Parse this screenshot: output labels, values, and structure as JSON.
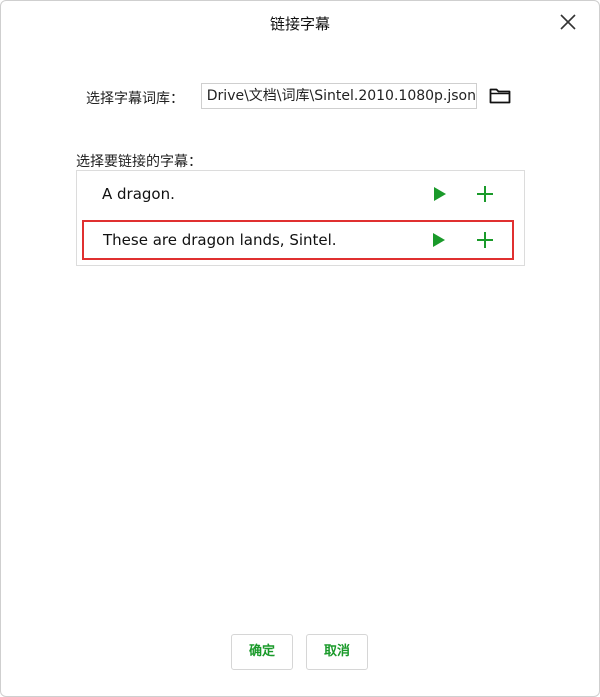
{
  "dialog": {
    "title": "链接字幕",
    "close_icon": "close-icon"
  },
  "library": {
    "label": "选择字幕词库：",
    "path": "Drive\\文档\\词库\\Sintel.2010.1080p.json",
    "folder_icon": "folder-icon"
  },
  "subtitles": {
    "label": "选择要链接的字幕：",
    "items": [
      {
        "text": "A dragon.",
        "selected": false
      },
      {
        "text": "These are dragon lands, Sintel.",
        "selected": true
      }
    ]
  },
  "buttons": {
    "confirm": "确定",
    "cancel": "取消"
  },
  "colors": {
    "accent": "#1a9a2a",
    "selection_border": "#e03030"
  }
}
